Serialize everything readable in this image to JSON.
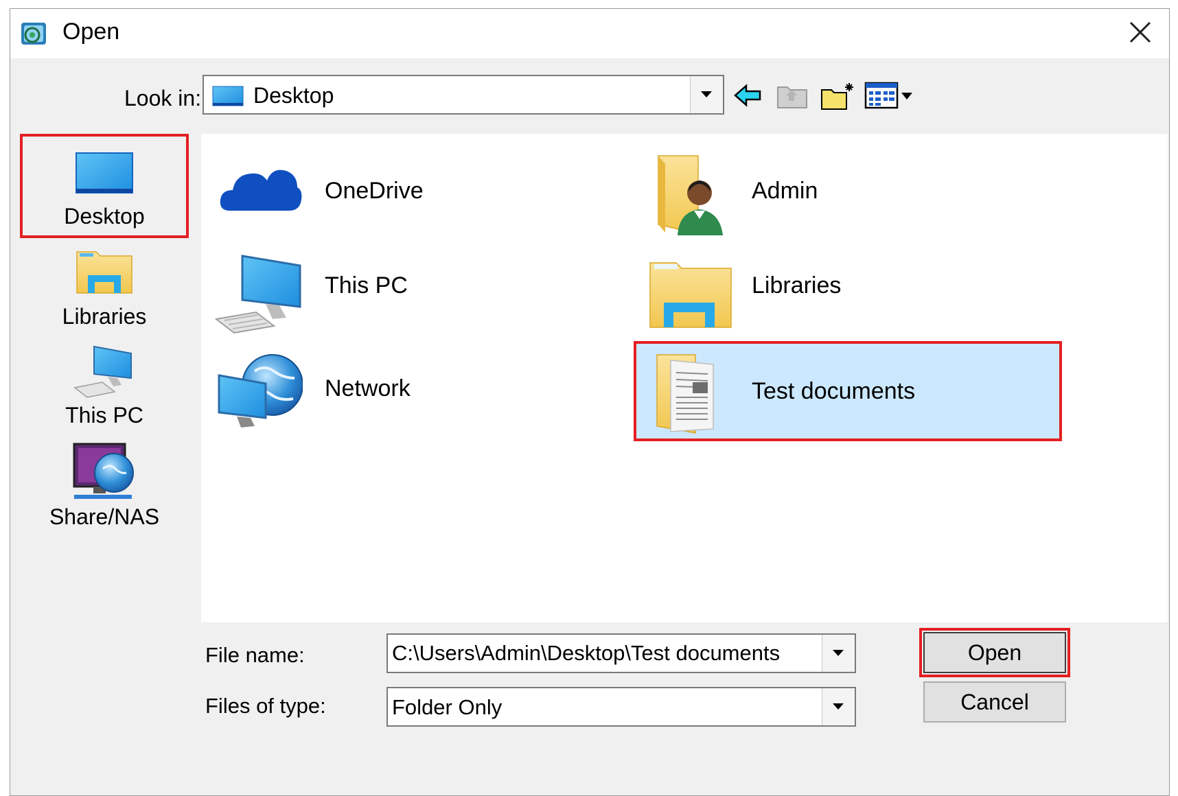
{
  "window": {
    "title": "Open",
    "icon": "app-globe-icon",
    "close_icon": "close-icon"
  },
  "look_in": {
    "label": "Look in:",
    "value": "Desktop",
    "icon": "desktop-icon"
  },
  "toolbar": {
    "back_icon": "back-arrow-icon",
    "up_icon": "up-folder-icon",
    "new_folder_icon": "new-folder-icon",
    "view_menu_icon": "view-menu-icon"
  },
  "places": [
    {
      "label": "Desktop",
      "icon": "desktop-icon",
      "selected": true
    },
    {
      "label": "Libraries",
      "icon": "libraries-icon",
      "selected": false
    },
    {
      "label": "This PC",
      "icon": "computer-icon",
      "selected": false
    },
    {
      "label": "Share/NAS",
      "icon": "network-share-icon",
      "selected": false
    }
  ],
  "files": [
    {
      "label": "OneDrive",
      "icon": "onedrive-icon",
      "selected": false
    },
    {
      "label": "This PC",
      "icon": "computer-icon",
      "selected": false
    },
    {
      "label": "Network",
      "icon": "network-icon",
      "selected": false
    },
    {
      "label": "Admin",
      "icon": "user-folder-icon",
      "selected": false
    },
    {
      "label": "Libraries",
      "icon": "libraries-icon",
      "selected": false
    },
    {
      "label": "Test documents",
      "icon": "documents-folder-icon",
      "selected": true
    }
  ],
  "file_name": {
    "label": "File name:",
    "value": "C:\\Users\\Admin\\Desktop\\Test documents"
  },
  "file_type": {
    "label": "Files of type:",
    "value": "Folder Only"
  },
  "buttons": {
    "open": "Open",
    "cancel": "Cancel"
  },
  "colors": {
    "selection_bg": "#cce8ff",
    "highlight_border": "#e41f22",
    "dialog_bg": "#f0f0f0"
  }
}
